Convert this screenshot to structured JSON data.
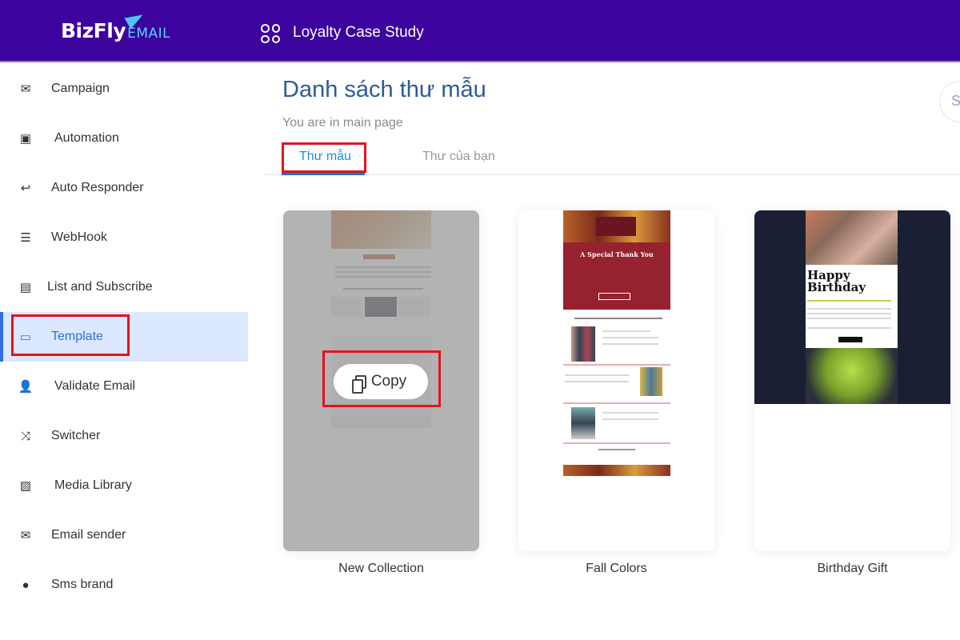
{
  "header": {
    "logo": "BizFly",
    "logo_suffix": "EMAIL",
    "project": "Loyalty Case Study",
    "bg": "#3c039f"
  },
  "sidebar": {
    "items": [
      {
        "label": "Campaign",
        "icon": "envelope-icon"
      },
      {
        "label": "Automation",
        "icon": "robot-icon"
      },
      {
        "label": "Auto Responder",
        "icon": "reply-all-icon"
      },
      {
        "label": "WebHook",
        "icon": "server-icon"
      },
      {
        "label": "List and Subscribe",
        "icon": "clipboard-icon"
      },
      {
        "label": "Template",
        "icon": "card-icon",
        "active": true
      },
      {
        "label": "Validate Email",
        "icon": "user-check-icon"
      },
      {
        "label": "Switcher",
        "icon": "shuffle-icon"
      },
      {
        "label": "Media Library",
        "icon": "images-icon"
      },
      {
        "label": "Email sender",
        "icon": "envelope-outline-icon"
      },
      {
        "label": "Sms brand",
        "icon": "chat-icon"
      }
    ]
  },
  "main": {
    "title": "Danh sách thư mẫu",
    "subtitle": "You are in main page",
    "search_partial": "S",
    "tabs": [
      {
        "label": "Thư mẫu",
        "active": true
      },
      {
        "label": "Thư của bạn"
      }
    ],
    "templates": [
      {
        "name": "New Collection",
        "hover_action": "Copy"
      },
      {
        "name": "Fall Colors",
        "preview_heading": "A Special Thank You"
      },
      {
        "name": "Birthday Gift",
        "preview_heading": "Happy Birthday"
      }
    ]
  }
}
